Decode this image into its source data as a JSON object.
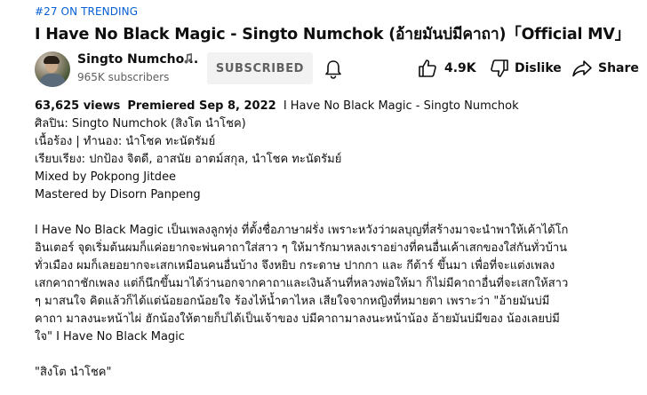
{
  "trending": "#27 ON TRENDING",
  "title": "I Have No Black Magic - Singto Numchok (อ้ายมันบ่มีคาถา)「Official MV」",
  "channel": {
    "name": "Singto Numcho...",
    "subscribers": "965K subscribers",
    "badge_icon": "music-note-icon"
  },
  "actions": {
    "subscribe_label": "SUBSCRIBED",
    "like_count": "4.9K",
    "dislike_label": "Dislike",
    "share_label": "Share"
  },
  "description": {
    "views": "63,625 views",
    "premiered": "Premiered Sep 8, 2022",
    "video_name": "I Have No Black Magic - Singto Numchok",
    "artist_line": "ศิลปิน: Singto Numchok (สิงโต นำโชค)",
    "lyrics_line": "เนื้อร้อง | ทำนอง: นำโชค ทะนัดรัมย์",
    "arrangement_line": "เรียบเรียง: ปกป้อง จิตดี, อาสนัย อาตม์สกุล, นำโชค ทะนัดรัมย์",
    "mixed_line": "Mixed by Pokpong Jitdee",
    "mastered_line": "Mastered by Disorn Panpeng",
    "body_lines": [
      "I Have No Black Magic  เป็นเพลงลูกทุ่ง ที่ตั้งชื่อภาษาฝรั่ง เพราะหวังว่าผลบุญที่สร้างมาจะนำพาให้เค้าได้โก",
      "อินเตอร์ จุดเริ่มต้นผมก็แค่อยากจะพ่นคาถาใส่สาว ๆ ให้มารักมาหลงเราอย่างที่คนอื่นเค้าเสกของใส่กันทั่วบ้าน",
      "ทั่วเมือง ผมก็เลยอยากจะเสกเหมือนคนอื่นบ้าง จึงหยิบ กระดาษ ปากกา และ กีต้าร์ ขึ้นมา เพื่อที่จะแต่งเพลง",
      "เสกคาถาชักเพลง แต่ก็นึกขึ้นมาได้ว่านอกจากคาถาและเงินล้านที่หลวงพ่อให้มา ก็ไม่มีคาถาอื่นที่จะเสกให้สาว",
      "ๆ มาสนใจ คิดแล้วก็ได้แต่น้อยอกน้อยใจ ร้องไห้น้ำตาไหล เสียใจจากหญิงที่หมายตา เพราะว่า  \"อ้ายมันบ่มี",
      "คาถา มาลงนะหน้าไผ่ ฮักน้องให้ตายก็บ่ได้เป็นเจ้าของ บ่มีคาถามาลงนะหน้าน้อง อ้ายมันบ่มีของ น้องเลยบ่มี",
      "ใจ\" I Have No Black Magic"
    ],
    "signature": "\"สิงโต นำโชค\""
  },
  "colors": {
    "trending": "#065fd4",
    "subscribed_bg": "#f2f2f2",
    "secondary_text": "#606060"
  }
}
